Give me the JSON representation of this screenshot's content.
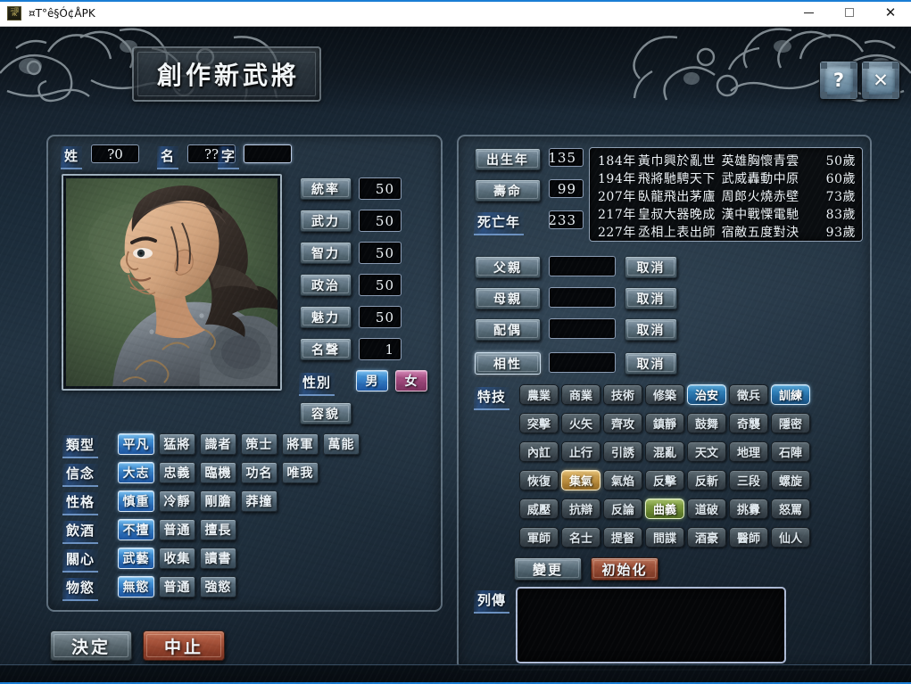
{
  "window": {
    "title": "¤T°ê§Ó¢ÅPK",
    "app_icon": "game-app-icon",
    "minimize_label": "",
    "maximize_label": "",
    "close_label": "✕"
  },
  "header": {
    "title": "創作新武將",
    "help_glyph": "?",
    "close_glyph": "✕"
  },
  "name_row": {
    "surname_label": "姓",
    "surname_value": "?0",
    "given_label": "名",
    "given_value": "??",
    "courtesy_label": "字",
    "courtesy_value": ""
  },
  "stats": [
    {
      "label": "統率",
      "value": "50"
    },
    {
      "label": "武力",
      "value": "50"
    },
    {
      "label": "智力",
      "value": "50"
    },
    {
      "label": "政治",
      "value": "50"
    },
    {
      "label": "魅力",
      "value": "50"
    },
    {
      "label": "名聲",
      "value": "1"
    }
  ],
  "gender": {
    "label": "性別",
    "male": "男",
    "female": "女",
    "selected": "男"
  },
  "appearance_button": "容貌",
  "traits": [
    {
      "label": "類型",
      "options": [
        "平凡",
        "猛將",
        "識者",
        "策士",
        "將軍",
        "萬能"
      ],
      "selected": 0
    },
    {
      "label": "信念",
      "options": [
        "大志",
        "忠義",
        "臨機",
        "功名",
        "唯我"
      ],
      "selected": 0
    },
    {
      "label": "性格",
      "options": [
        "慎重",
        "冷靜",
        "剛膽",
        "莽撞"
      ],
      "selected": 0
    },
    {
      "label": "飲酒",
      "options": [
        "不擅",
        "普通",
        "擅長"
      ],
      "selected": 0
    },
    {
      "label": "關心",
      "options": [
        "武藝",
        "收集",
        "讀書"
      ],
      "selected": 0
    },
    {
      "label": "物慾",
      "options": [
        "無慾",
        "普通",
        "強慾"
      ],
      "selected": 0
    }
  ],
  "lifespan": {
    "birth_year_label": "出生年",
    "birth_year_value": "135",
    "lifespan_label": "壽命",
    "lifespan_value": "99",
    "death_year_label": "死亡年",
    "death_year_value": "233"
  },
  "events": [
    {
      "year": "184年",
      "text1": "黃巾興於亂世",
      "text2": "英雄胸懷青雲",
      "age": "50歲"
    },
    {
      "year": "194年",
      "text1": "飛將馳騁天下",
      "text2": "武威轟動中原",
      "age": "60歲"
    },
    {
      "year": "207年",
      "text1": "臥龍飛出茅廬",
      "text2": "周郎火燒赤壁",
      "age": "73歲"
    },
    {
      "year": "217年",
      "text1": "皇叔大器晚成",
      "text2": "漢中戰慄電馳",
      "age": "83歲"
    },
    {
      "year": "227年",
      "text1": "丞相上表出師",
      "text2": "宿敵五度對決",
      "age": "93歲"
    }
  ],
  "relations": [
    {
      "label": "父親",
      "value": "",
      "cancel": "取消",
      "focused": false
    },
    {
      "label": "母親",
      "value": "",
      "cancel": "取消",
      "focused": false
    },
    {
      "label": "配偶",
      "value": "",
      "cancel": "取消",
      "focused": false
    },
    {
      "label": "相性",
      "value": "",
      "cancel": "取消",
      "focused": true
    }
  ],
  "skills": {
    "label": "特技",
    "rows": [
      [
        {
          "name": "農業",
          "state": "off"
        },
        {
          "name": "商業",
          "state": "off"
        },
        {
          "name": "技術",
          "state": "off"
        },
        {
          "name": "修築",
          "state": "off"
        },
        {
          "name": "治安",
          "state": "blue"
        },
        {
          "name": "徵兵",
          "state": "off"
        },
        {
          "name": "訓練",
          "state": "blue"
        }
      ],
      [
        {
          "name": "突擊",
          "state": "off"
        },
        {
          "name": "火矢",
          "state": "off"
        },
        {
          "name": "齊攻",
          "state": "off"
        },
        {
          "name": "鎮靜",
          "state": "off"
        },
        {
          "name": "鼓舞",
          "state": "off"
        },
        {
          "name": "奇襲",
          "state": "off"
        },
        {
          "name": "隱密",
          "state": "off"
        }
      ],
      [
        {
          "name": "內訌",
          "state": "off"
        },
        {
          "name": "止行",
          "state": "off"
        },
        {
          "name": "引誘",
          "state": "off"
        },
        {
          "name": "混亂",
          "state": "off"
        },
        {
          "name": "天文",
          "state": "off"
        },
        {
          "name": "地理",
          "state": "off"
        },
        {
          "name": "石陣",
          "state": "off"
        }
      ],
      [
        {
          "name": "恢復",
          "state": "off"
        },
        {
          "name": "集氣",
          "state": "gold"
        },
        {
          "name": "氣焰",
          "state": "off"
        },
        {
          "name": "反擊",
          "state": "off"
        },
        {
          "name": "反斬",
          "state": "off"
        },
        {
          "name": "三段",
          "state": "off"
        },
        {
          "name": "螺旋",
          "state": "off"
        }
      ],
      [
        {
          "name": "威壓",
          "state": "off"
        },
        {
          "name": "抗辯",
          "state": "off"
        },
        {
          "name": "反論",
          "state": "off"
        },
        {
          "name": "曲義",
          "state": "green"
        },
        {
          "name": "道破",
          "state": "off"
        },
        {
          "name": "挑釁",
          "state": "off"
        },
        {
          "name": "怒罵",
          "state": "off"
        }
      ],
      [
        {
          "name": "軍師",
          "state": "off"
        },
        {
          "name": "名士",
          "state": "off"
        },
        {
          "name": "提督",
          "state": "off"
        },
        {
          "name": "間諜",
          "state": "off"
        },
        {
          "name": "酒豪",
          "state": "off"
        },
        {
          "name": "醫師",
          "state": "off"
        },
        {
          "name": "仙人",
          "state": "off"
        }
      ]
    ]
  },
  "skill_actions": {
    "change": "變更",
    "reset": "初始化"
  },
  "biography": {
    "label": "列傳",
    "text": ""
  },
  "footer": {
    "confirm": "決定",
    "cancel": "中止",
    "status_text": ""
  },
  "colors": {
    "accent_blue": "#2e7fb8",
    "selected_gold": "#c79a4a",
    "selected_green": "#7c9a3e",
    "female_pink": "#a74e82",
    "cancel_red": "#a9553c"
  }
}
